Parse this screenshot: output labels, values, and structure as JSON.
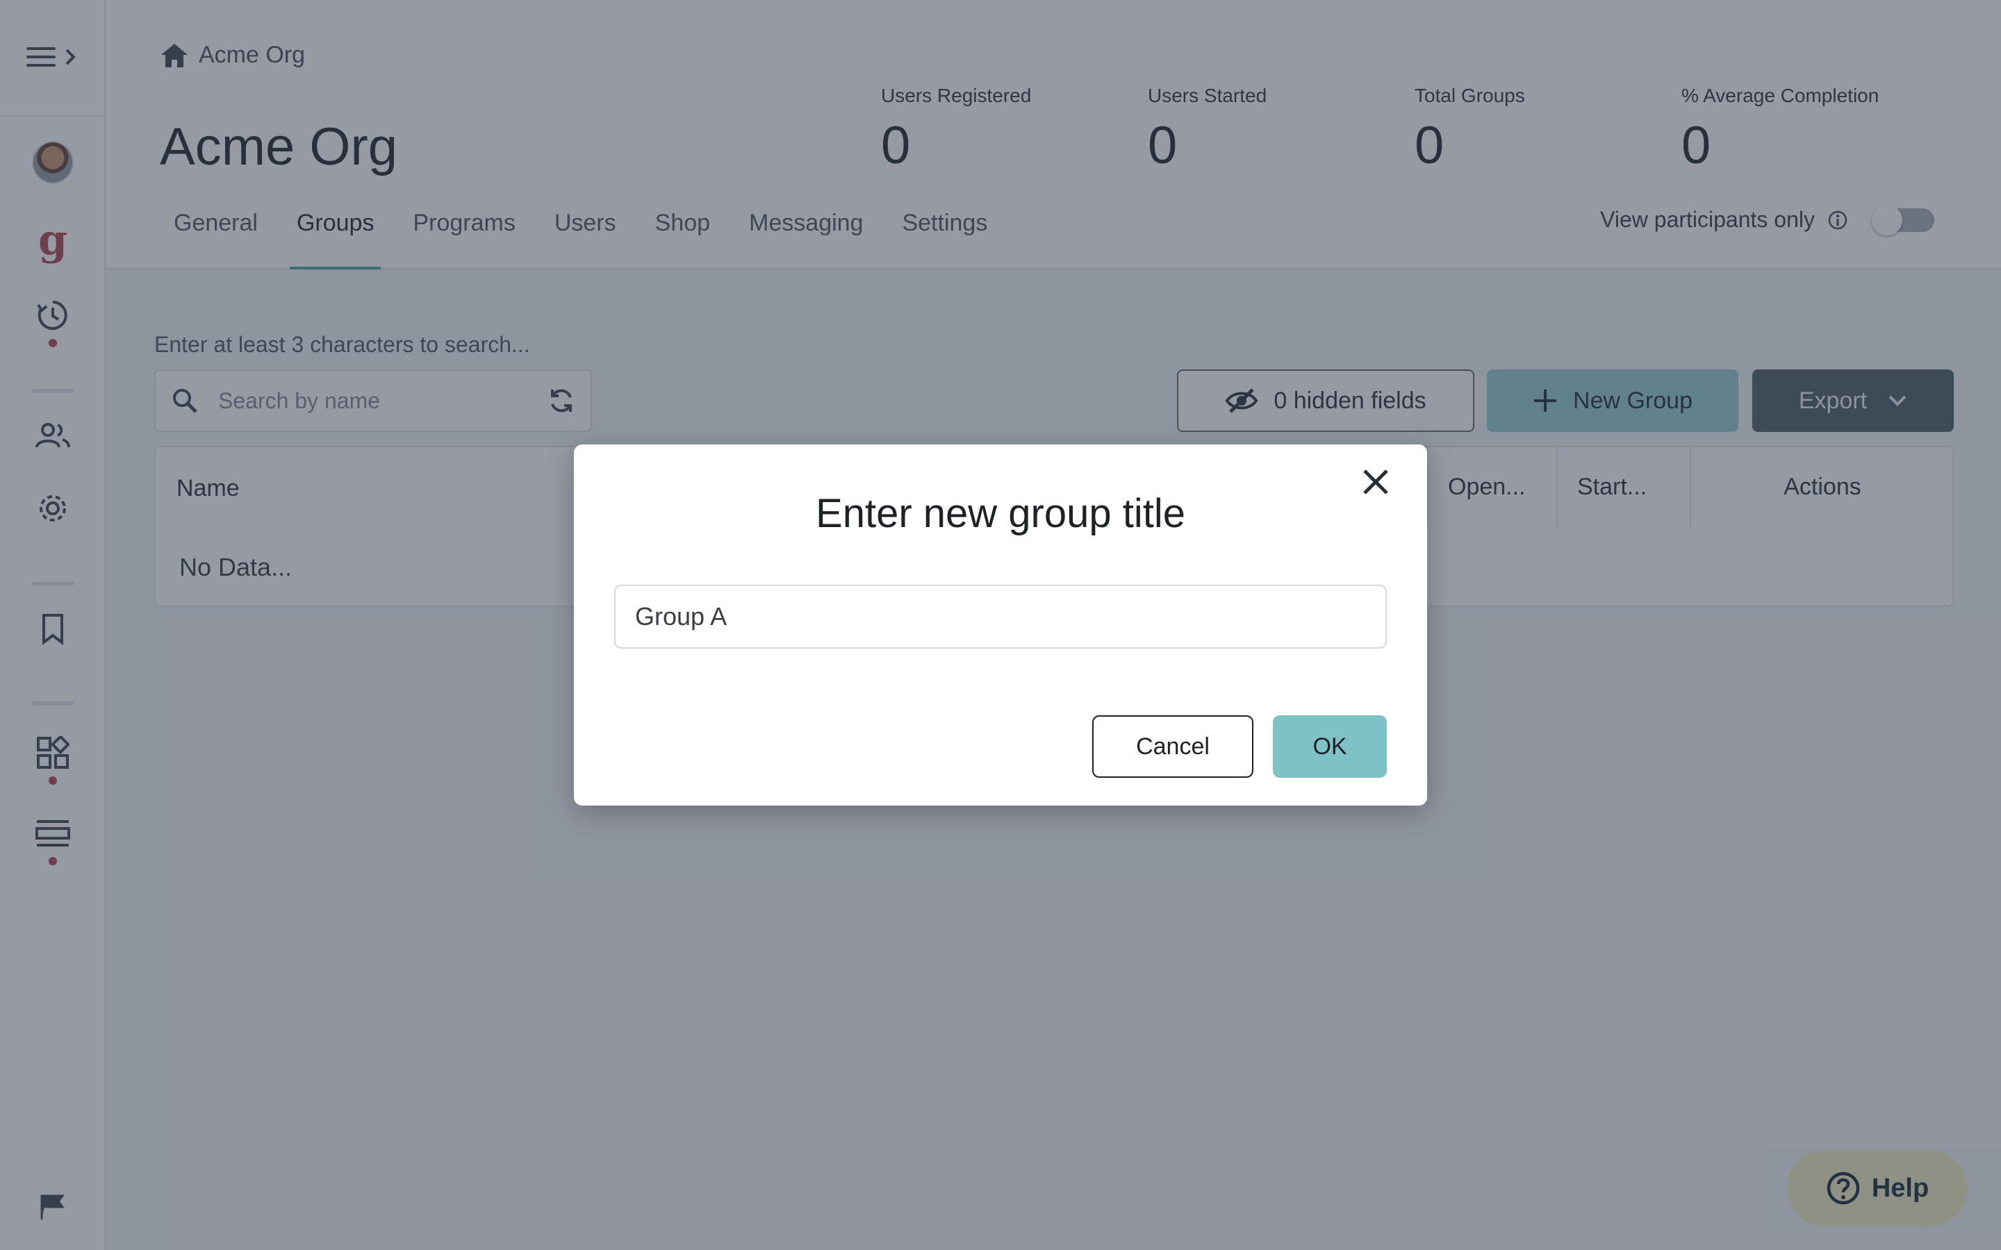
{
  "breadcrumb": {
    "label": "Acme Org"
  },
  "page": {
    "title": "Acme Org"
  },
  "stats": [
    {
      "label": "Users Registered",
      "value": "0"
    },
    {
      "label": "Users Started",
      "value": "0"
    },
    {
      "label": "Total Groups",
      "value": "0"
    },
    {
      "label": "% Average Completion",
      "value": "0"
    }
  ],
  "tabs": [
    {
      "label": "General"
    },
    {
      "label": "Groups",
      "active": true
    },
    {
      "label": "Programs"
    },
    {
      "label": "Users"
    },
    {
      "label": "Shop"
    },
    {
      "label": "Messaging"
    },
    {
      "label": "Settings"
    }
  ],
  "toggle": {
    "label": "View participants only",
    "on": false
  },
  "search": {
    "hint": "Enter at least 3 characters to search...",
    "placeholder": "Search by name"
  },
  "toolbar": {
    "hidden_fields_label": "0 hidden fields",
    "new_group_label": "New Group",
    "export_label": "Export"
  },
  "table": {
    "columns": [
      "Name",
      "Open...",
      "Start...",
      "Actions"
    ],
    "empty_text": "No Data..."
  },
  "help": {
    "label": "Help"
  },
  "dialog": {
    "title": "Enter new group title",
    "input_value": "Group A",
    "cancel_label": "Cancel",
    "ok_label": "OK"
  },
  "colors": {
    "accent": "#7fc2c5",
    "export_button": "#58676f",
    "sidebar_brand": "#b5525a",
    "help_bg": "#f1edc4"
  },
  "icons": [
    "menu-icon",
    "chevron-right-icon",
    "avatar",
    "brand-g-icon",
    "history-icon",
    "users-icon",
    "gear-icon",
    "bookmark-icon",
    "apps-icon",
    "layout-icon",
    "flag-icon",
    "home-icon",
    "info-icon",
    "search-icon",
    "refresh-icon",
    "eye-off-icon",
    "plus-icon",
    "chevron-down-icon",
    "help-circle-icon",
    "close-icon"
  ]
}
